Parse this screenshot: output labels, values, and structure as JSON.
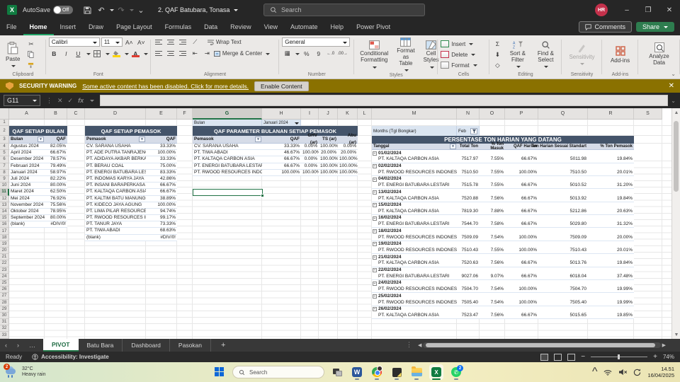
{
  "titlebar": {
    "autosave_label": "AutoSave",
    "autosave_state": "Off",
    "doc_title": "2. QAF Batubara, Tonasa",
    "search_placeholder": "Search",
    "avatar_initials": "HR"
  },
  "ribbon": {
    "tabs": [
      "File",
      "Home",
      "Insert",
      "Draw",
      "Page Layout",
      "Formulas",
      "Data",
      "Review",
      "View",
      "Automate",
      "Help",
      "Power Pivot"
    ],
    "active_tab": "Home",
    "comments_label": "Comments",
    "share_label": "Share",
    "clipboard": {
      "paste": "Paste"
    },
    "font": {
      "name": "Calibri",
      "size": "11",
      "bold": "B",
      "italic": "I",
      "underline": "U"
    },
    "alignment": {
      "wrap_text": "Wrap Text",
      "merge_center": "Merge & Center"
    },
    "number": {
      "format": "General",
      "percent": "%",
      "comma": "9"
    },
    "styles": {
      "conditional": "Conditional Formatting",
      "format_table": "Format as Table",
      "cell_styles": "Cell Styles"
    },
    "cells": {
      "insert": "Insert",
      "delete": "Delete",
      "format": "Format"
    },
    "editing": {
      "autosum": "Σ",
      "sort_filter": "Sort & Filter",
      "find_select": "Find & Select"
    },
    "sensitivity_label": "Sensitivity",
    "addins_label": "Add-ins",
    "analyze_label": "Analyze Data",
    "group_labels": {
      "clipboard": "Clipboard",
      "font": "Font",
      "alignment": "Alignment",
      "number": "Number",
      "styles": "Styles",
      "cells": "Cells",
      "editing": "Editing",
      "sensitivity": "Sensitivity",
      "addins": "Add-ins"
    }
  },
  "security_bar": {
    "title": "SECURITY WARNING",
    "message": "Some active content has been disabled. Click for more details.",
    "button_label": "Enable Content"
  },
  "formula_bar": {
    "name_box": "G11",
    "fx": "fx"
  },
  "grid": {
    "columns": [
      "A",
      "B",
      "C",
      "D",
      "E",
      "F",
      "G",
      "H",
      "I",
      "J",
      "K",
      "L",
      "M",
      "N",
      "O",
      "P",
      "Q",
      "R",
      "S"
    ],
    "row_numbers": [
      "1",
      "2",
      "3",
      "4",
      "5",
      "6",
      "7",
      "8",
      "9",
      "10",
      "11",
      "12",
      "13",
      "14",
      "15",
      "16",
      "17",
      "18",
      "19",
      "20",
      "21",
      "22",
      "23",
      "24",
      "25",
      "26",
      "27",
      "28",
      "29",
      "30",
      "31",
      "32",
      "33"
    ],
    "selected_col": "G",
    "selected_row": "11"
  },
  "tables": {
    "qaf_bulan": {
      "title": "QAF SETIAP BULAN",
      "headers": [
        "Bulan",
        "QAF"
      ],
      "rows": [
        {
          "label": "Agustus 2024",
          "value": "82.05%"
        },
        {
          "label": "April 2024",
          "value": "66.67%"
        },
        {
          "label": "Desember 2024",
          "value": "78.57%"
        },
        {
          "label": "Februari 2024",
          "value": "79.49%"
        },
        {
          "label": "Januari 2024",
          "value": "58.97%"
        },
        {
          "label": "Juli 2024",
          "value": "82.22%"
        },
        {
          "label": "Juni 2024",
          "value": "80.00%"
        },
        {
          "label": "Maret 2024",
          "value": "62.50%"
        },
        {
          "label": "Mei 2024",
          "value": "76.92%"
        },
        {
          "label": "November 2024",
          "value": "75.56%"
        },
        {
          "label": "Oktober 2024",
          "value": "78.95%"
        },
        {
          "label": "September 2024",
          "value": "80.00%"
        },
        {
          "label": "(blank)",
          "value": "#DIV/0!"
        }
      ]
    },
    "qaf_pemasok": {
      "title": "QAF SETIAP PEMASOK",
      "headers": [
        "Pemasok",
        "QAF"
      ],
      "rows": [
        {
          "label": "CV. SARANA USAHA",
          "value": "33.33%"
        },
        {
          "label": "PT. ADE PUTRA TANRAJENG",
          "value": "100.00%"
        },
        {
          "label": "PT. ADIDAYA AKBAR BERKARYA",
          "value": "33.33%"
        },
        {
          "label": "PT. BERAU COAL",
          "value": "75.00%"
        },
        {
          "label": "PT. ENERGI BATUBARA LESTARI",
          "value": "83.33%"
        },
        {
          "label": "PT. INDOMAS KARYA JAYA",
          "value": "42.86%"
        },
        {
          "label": "PT. INSANI BARAPERKASA",
          "value": "66.67%"
        },
        {
          "label": "PT. KALTAQA CARBON ASIA",
          "value": "66.67%"
        },
        {
          "label": "PT. KALTIM BATU MANUNGGAL",
          "value": "38.89%"
        },
        {
          "label": "PT. KIDECO JAYA AGUNG",
          "value": "100.00%"
        },
        {
          "label": "PT. LIMA PILAR RESOURCES",
          "value": "94.74%"
        },
        {
          "label": "PT. RWOOD RESOURCES INDONESIA",
          "value": "99.17%"
        },
        {
          "label": "PT. TANUR JAYA",
          "value": "73.33%"
        },
        {
          "label": "PT. TIWA ABADI",
          "value": "68.63%"
        },
        {
          "label": "(blank)",
          "value": "#DIV/0!"
        }
      ]
    },
    "qaf_parameter": {
      "filter_label": "Bulan",
      "filter_value": "Januari 2024",
      "title": "QAF PARAMETER BULANAN SETIAP PEMASOK",
      "headers": [
        "Pemasok",
        "QAF",
        "GHV (ar)",
        "TS (ar)",
        "Abu (ar)"
      ],
      "rows": [
        {
          "pemasok": "CV. SARANA USAHA",
          "qaf": "33.33%",
          "ghv": "0.00%",
          "ts": "100.00%",
          "abu": "0.00%"
        },
        {
          "pemasok": "PT. TIWA ABADI",
          "qaf": "46.67%",
          "ghv": "100.00%",
          "ts": "20.00%",
          "abu": "20.00%"
        },
        {
          "pemasok": "PT. KALTAQA CARBON ASIA",
          "qaf": "66.67%",
          "ghv": "0.00%",
          "ts": "100.00%",
          "abu": "100.00%"
        },
        {
          "pemasok": "PT. ENERGI BATUBARA LESTARI",
          "qaf": "66.67%",
          "ghv": "0.00%",
          "ts": "100.00%",
          "abu": "100.00%"
        },
        {
          "pemasok": "PT. RWOOD RESOURCES INDONESIA",
          "qaf": "100.00%",
          "ghv": "100.00%",
          "ts": "100.00%",
          "abu": "100.00%"
        }
      ]
    },
    "ton_harian": {
      "filter_label": "Months (Tgl Bongkar)",
      "filter_value": "Feb",
      "title": "PERSENTASE TON HARIAN YANG DATANG",
      "headers": [
        "Tanggal",
        "Total Ton",
        "% Ton Masuk",
        "QAF Harian",
        "Ton Harian Sesuai Standart",
        "% Ton Pemasok"
      ],
      "groups": [
        {
          "date": "01/02/2024",
          "pemasok": "PT. KALTAQA CARBON ASIA",
          "total": "7517.97",
          "masuk": "7.55%",
          "qaf": "66.67%",
          "standart": "5011.98",
          "pemasok_pct": "19.84%"
        },
        {
          "date": "02/02/2024",
          "pemasok": "PT. RWOOD RESOURCES INDONESIA",
          "total": "7510.50",
          "masuk": "7.55%",
          "qaf": "100.00%",
          "standart": "7510.50",
          "pemasok_pct": "20.01%"
        },
        {
          "date": "04/02/2024",
          "pemasok": "PT. ENERGI BATUBARA LESTARI",
          "total": "7515.78",
          "masuk": "7.55%",
          "qaf": "66.67%",
          "standart": "5010.52",
          "pemasok_pct": "31.20%"
        },
        {
          "date": "13/02/2024",
          "pemasok": "PT. KALTAQA CARBON ASIA",
          "total": "7520.88",
          "masuk": "7.56%",
          "qaf": "66.67%",
          "standart": "5013.92",
          "pemasok_pct": "19.84%"
        },
        {
          "date": "15/02/2024",
          "pemasok": "PT. KALTAQA CARBON ASIA",
          "total": "7819.30",
          "masuk": "7.88%",
          "qaf": "66.67%",
          "standart": "5212.86",
          "pemasok_pct": "20.63%"
        },
        {
          "date": "16/02/2024",
          "pemasok": "PT. ENERGI BATUBARA LESTARI",
          "total": "7544.70",
          "masuk": "7.58%",
          "qaf": "66.67%",
          "standart": "5029.80",
          "pemasok_pct": "31.32%"
        },
        {
          "date": "18/02/2024",
          "pemasok": "PT. RWOOD RESOURCES INDONESIA",
          "total": "7509.09",
          "masuk": "7.54%",
          "qaf": "100.00%",
          "standart": "7509.09",
          "pemasok_pct": "20.00%"
        },
        {
          "date": "19/02/2024",
          "pemasok": "PT. RWOOD RESOURCES INDONESIA",
          "total": "7510.43",
          "masuk": "7.55%",
          "qaf": "100.00%",
          "standart": "7510.43",
          "pemasok_pct": "20.01%"
        },
        {
          "date": "21/02/2024",
          "pemasok": "PT. KALTAQA CARBON ASIA",
          "total": "7520.63",
          "masuk": "7.56%",
          "qaf": "66.67%",
          "standart": "5013.76",
          "pemasok_pct": "19.84%"
        },
        {
          "date": "22/02/2024",
          "pemasok": "PT. ENERGI BATUBARA LESTARI",
          "total": "9027.06",
          "masuk": "9.07%",
          "qaf": "66.67%",
          "standart": "6018.04",
          "pemasok_pct": "37.48%"
        },
        {
          "date": "24/02/2024",
          "pemasok": "PT. RWOOD RESOURCES INDONESIA",
          "total": "7504.70",
          "masuk": "7.54%",
          "qaf": "100.00%",
          "standart": "7504.70",
          "pemasok_pct": "19.99%"
        },
        {
          "date": "25/02/2024",
          "pemasok": "PT. RWOOD RESOURCES INDONESIA",
          "total": "7505.40",
          "masuk": "7.54%",
          "qaf": "100.00%",
          "standart": "7505.40",
          "pemasok_pct": "19.99%"
        },
        {
          "date": "26/02/2024",
          "pemasok": "PT. KALTAQA CARBON ASIA",
          "total": "7523.47",
          "masuk": "7.56%",
          "qaf": "66.67%",
          "standart": "5015.65",
          "pemasok_pct": "19.85%"
        }
      ]
    }
  },
  "sheet_tabs": {
    "tabs": [
      "PIVOT",
      "Batu Bara",
      "Dashboard",
      "Pasokan"
    ],
    "active": "PIVOT"
  },
  "status_bar": {
    "ready": "Ready",
    "accessibility": "Accessibility: Investigate",
    "zoom": "74%"
  },
  "taskbar": {
    "weather": {
      "temp": "32°C",
      "desc": "Heavy rain",
      "badge": "2"
    },
    "search_placeholder": "Search",
    "whatsapp_badge": "2",
    "clock": {
      "time": "14.51",
      "date": "16/04/2025"
    }
  }
}
